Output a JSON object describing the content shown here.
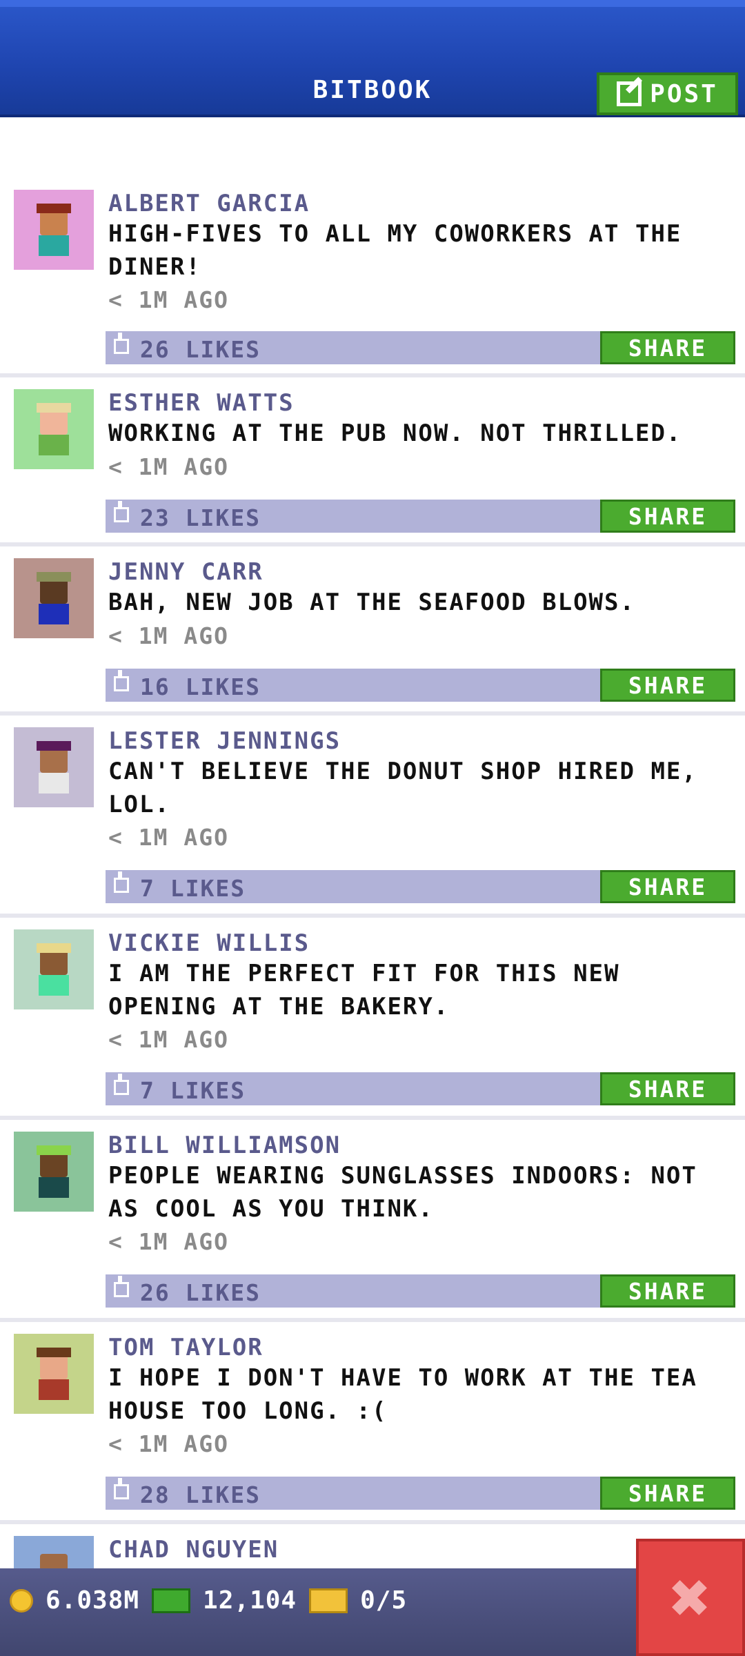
{
  "header": {
    "title": "BITBOOK",
    "post_label": "POST"
  },
  "posts": [
    {
      "name": "ALBERT GARCIA",
      "message": "HIGH-FIVES TO ALL MY COWORKERS AT THE DINER!",
      "time": "< 1M AGO",
      "likes": "26 LIKES",
      "share": "SHARE"
    },
    {
      "name": "ESTHER WATTS",
      "message": "WORKING AT THE PUB NOW. NOT THRILLED.",
      "time": "< 1M AGO",
      "likes": "23 LIKES",
      "share": "SHARE"
    },
    {
      "name": "JENNY CARR",
      "message": "BAH, NEW JOB AT THE SEAFOOD BLOWS.",
      "time": "< 1M AGO",
      "likes": "16 LIKES",
      "share": "SHARE"
    },
    {
      "name": "LESTER JENNINGS",
      "message": "CAN'T BELIEVE THE DONUT SHOP HIRED ME, LOL.",
      "time": "< 1M AGO",
      "likes": "7 LIKES",
      "share": "SHARE"
    },
    {
      "name": "VICKIE WILLIS",
      "message": "I AM THE PERFECT FIT FOR THIS NEW OPENING AT THE BAKERY.",
      "time": "< 1M AGO",
      "likes": "7 LIKES",
      "share": "SHARE"
    },
    {
      "name": "BILL WILLIAMSON",
      "message": "PEOPLE WEARING SUNGLASSES INDOORS: NOT AS COOL AS YOU THINK.",
      "time": "< 1M AGO",
      "likes": "26 LIKES",
      "share": "SHARE"
    },
    {
      "name": "TOM TAYLOR",
      "message": "I HOPE I DON'T HAVE TO WORK AT THE TEA HOUSE TOO LONG. :(",
      "time": "< 1M AGO",
      "likes": "28 LIKES",
      "share": "SHARE"
    },
    {
      "name": "CHAD NGUYEN"
    }
  ],
  "status_bar": {
    "coins": "6.038M",
    "bux": "12,104",
    "tickets": "0/5"
  },
  "colors": {
    "header_blue": "#1f45b0",
    "share_green": "#4bab2f",
    "likes_bar": "#b1b2d8",
    "close_red": "#e34545"
  }
}
